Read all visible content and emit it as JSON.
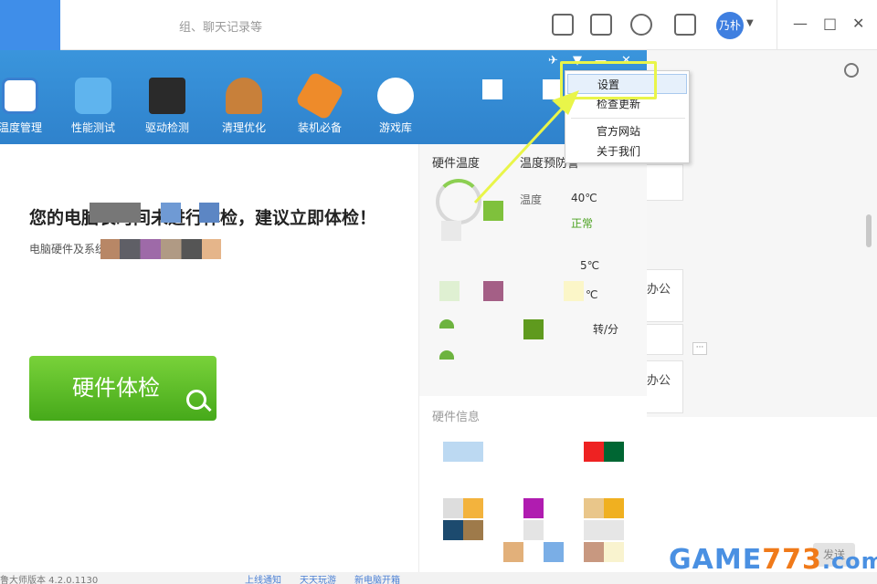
{
  "outer": {
    "search_placeholder": "组、聊天记录等",
    "avatar_text": "乃朴",
    "min_icon": "—",
    "max_icon": "□",
    "close_icon": "✕"
  },
  "right_panel": {
    "card1": "办公",
    "card2": "办公",
    "more": "···",
    "send_label": "发送"
  },
  "tool": {
    "header_controls": [
      "✈",
      "▼",
      "—",
      "✕"
    ],
    "tabs": [
      {
        "label": "温度管理"
      },
      {
        "label": "性能测试"
      },
      {
        "label": "驱动检测"
      },
      {
        "label": "清理优化"
      },
      {
        "label": "装机必备"
      },
      {
        "label": "游戏库"
      }
    ],
    "headline": "您的电脑长时间未进行体检，建议立即体检！",
    "subline": "电脑硬件及系统温度和性能都在下降",
    "check_button": "硬件体检",
    "side_title": "硬件温度",
    "side_title2": "温度预防警",
    "temp_label": "温度",
    "temp_value": "40℃",
    "temp_status": "正常",
    "temp_value2": "5℃",
    "temp_value3": "℃",
    "fan_value": "转/分",
    "side_section": "硬件信息"
  },
  "menu": {
    "items": [
      "设置",
      "检查更新",
      "官方网站",
      "关于我们"
    ],
    "active_index": 0
  },
  "status_bar": {
    "version": "鲁大师版本 4.2.0.1130",
    "link1": "上线通知",
    "link2": "天天玩游",
    "link3": "新电脑开箱"
  },
  "watermark": {
    "part1": "GAME",
    "part2": "773",
    "part3": ".com"
  },
  "colors": {
    "header_blue": "#3a95dc",
    "check_green": "#5cbf26",
    "highlight_yellow": "#e9f549"
  }
}
